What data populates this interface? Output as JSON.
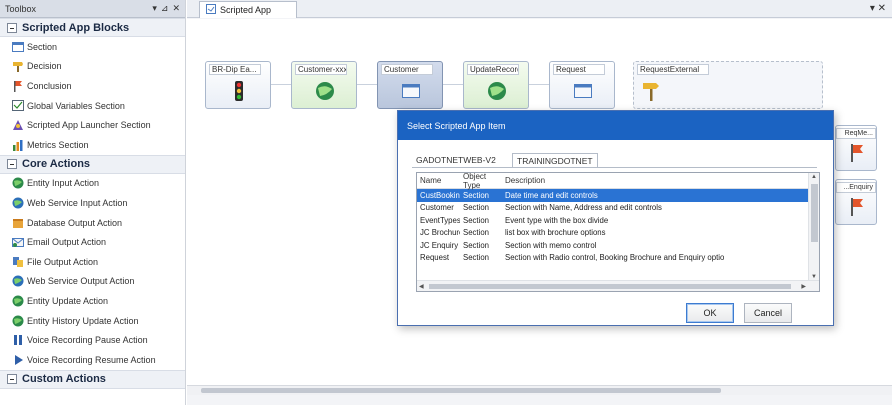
{
  "toolbox": {
    "title": "Toolbox",
    "controls": [
      "▾",
      "⊿",
      "✕"
    ],
    "groups": [
      {
        "label": "Scripted App Blocks",
        "items": [
          {
            "label": "Section",
            "icon": "section-icon"
          },
          {
            "label": "Decision",
            "icon": "decision-icon"
          },
          {
            "label": "Conclusion",
            "icon": "conclusion-icon"
          },
          {
            "label": "Global Variables Section",
            "icon": "global-variables-icon"
          },
          {
            "label": "Scripted App Launcher Section",
            "icon": "launcher-icon"
          },
          {
            "label": "Metrics Section",
            "icon": "metrics-icon"
          }
        ]
      },
      {
        "label": "Core Actions",
        "items": [
          {
            "label": "Entity Input Action",
            "icon": "globe-icon"
          },
          {
            "label": "Web Service Input Action",
            "icon": "globe-icon"
          },
          {
            "label": "Database Output Action",
            "icon": "database-icon"
          },
          {
            "label": "Email Output Action",
            "icon": "email-icon"
          },
          {
            "label": "File Output Action",
            "icon": "file-icon"
          },
          {
            "label": "Web Service Output Action",
            "icon": "globe-icon"
          },
          {
            "label": "Entity Update Action",
            "icon": "globe-icon"
          },
          {
            "label": "Entity History Update Action",
            "icon": "globe-icon"
          },
          {
            "label": "Voice Recording Pause Action",
            "icon": "pause-icon"
          },
          {
            "label": "Voice Recording Resume Action",
            "icon": "play-icon"
          }
        ]
      },
      {
        "label": "Custom Actions",
        "items": []
      }
    ]
  },
  "document": {
    "tab_label": "Scripted App",
    "close_glyph": "▾ ✕",
    "blocks": [
      {
        "label": "BR-Dip Ea...",
        "icon": "traffic-light-icon"
      },
      {
        "label": "Customer-xxx",
        "icon": "globe-icon"
      },
      {
        "label": "Customer",
        "icon": "window-icon"
      },
      {
        "label": "UpdateRecord",
        "icon": "globe-icon"
      },
      {
        "label": "Request",
        "icon": "window-icon"
      },
      {
        "label": "RequestExternal",
        "icon": "signpost-icon"
      }
    ],
    "right_blocks": [
      {
        "label": "ReqMe...",
        "icon": "flag-icon"
      },
      {
        "label": "...Enquiry",
        "icon": "flag-icon"
      }
    ]
  },
  "dialog": {
    "title": "Select Scripted App Item",
    "tabs": [
      "GADOTNETWEB-V2",
      "TRAININGDOTNET"
    ],
    "columns": [
      "Name",
      "Object Type",
      "Description"
    ],
    "rows": [
      {
        "name": "CustBooking",
        "type": "Section",
        "description": "Date time and edit controls",
        "selected": true
      },
      {
        "name": "Customer",
        "type": "Section",
        "description": "Section with Name, Address and edit controls",
        "selected": false
      },
      {
        "name": "EventTypes",
        "type": "Section",
        "description": "Event type with the box divide",
        "selected": false
      },
      {
        "name": "JC Brochure",
        "type": "Section",
        "description": "list box with brochure options",
        "selected": false
      },
      {
        "name": "JC Enquiry",
        "type": "Section",
        "description": "Section with memo control",
        "selected": false
      },
      {
        "name": "Request",
        "type": "Section",
        "description": "Section with Radio control, Booking Brochure and Enquiry optio",
        "selected": false
      }
    ],
    "ok_label": "OK",
    "cancel_label": "Cancel"
  },
  "colors": {
    "dialog_title_bg": "#1b63c2",
    "selection": "#2a73d3",
    "toolbox_group_text": "#1b2a44"
  }
}
